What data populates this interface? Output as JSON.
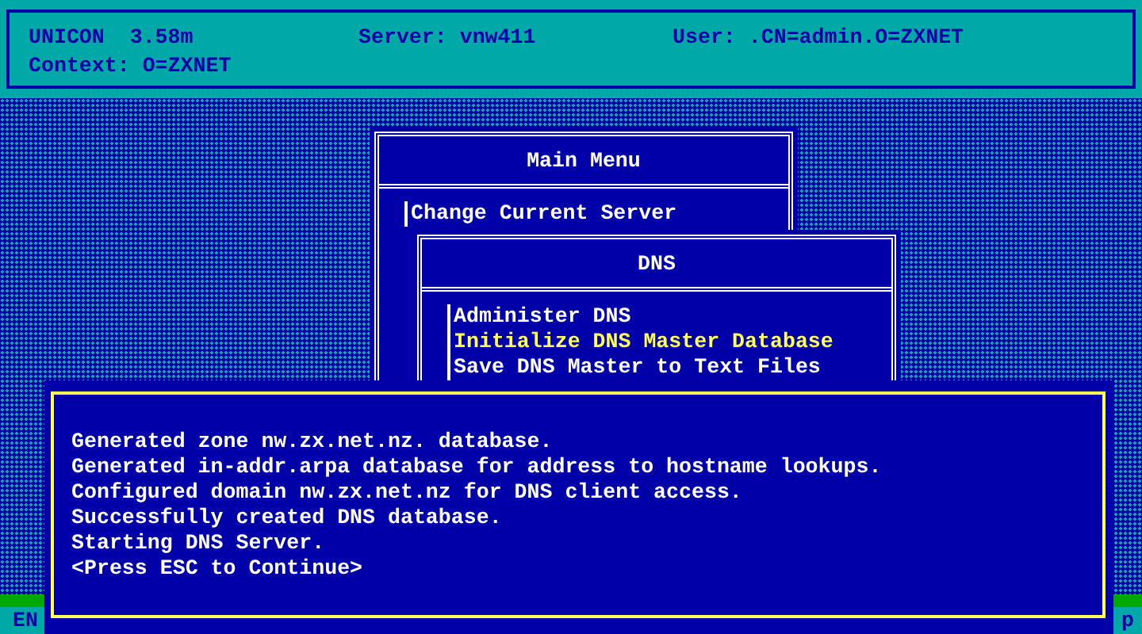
{
  "header": {
    "program": "UNICON  3.58m",
    "server": "Server: vnw411",
    "user": "User: .CN=admin.O=ZXNET",
    "context": "Context: O=ZXNET"
  },
  "main_menu": {
    "title": "Main Menu",
    "items": [
      {
        "label": "Change Current Server",
        "selected": false
      }
    ]
  },
  "dns_menu": {
    "title": "DNS",
    "items": [
      {
        "label": "Administer DNS",
        "selected": false
      },
      {
        "label": "Initialize DNS Master Database",
        "selected": true
      },
      {
        "label": "Save DNS Master to Text Files",
        "selected": false
      }
    ]
  },
  "message": {
    "lines": [
      "Generated zone nw.zx.net.nz. database.",
      "Generated in-addr.arpa database for address to hostname lookups.",
      "Configured domain nw.zx.net.nz for DNS client access.",
      "Successfully created DNS database.",
      "Starting DNS Server.",
      "<Press ESC to Continue>"
    ]
  },
  "status_bar": {
    "left": "EN",
    "right": "p"
  }
}
